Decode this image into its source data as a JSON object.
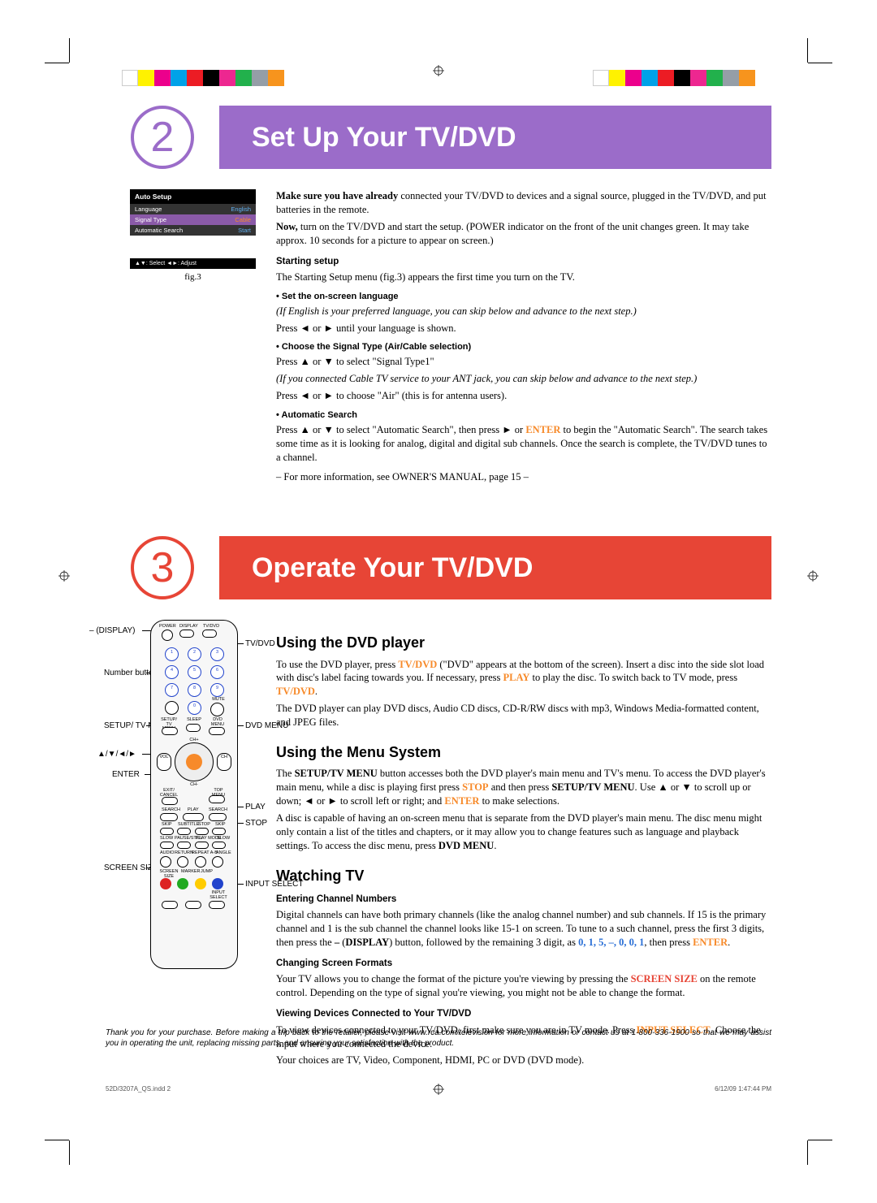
{
  "colorbar": [
    "#ffffff",
    "#fff200",
    "#ec008c",
    "#00a2e8",
    "#ec1c24",
    "#000000",
    "#ed2790",
    "#22b14c",
    "#959ea7",
    "#f7941d"
  ],
  "section2": {
    "number": "2",
    "title": "Set Up Your TV/DVD",
    "auto_setup": {
      "title": "Auto Setup",
      "rows": [
        {
          "label": "Language",
          "value": "English",
          "class": "en",
          "hl": false
        },
        {
          "label": "Signal Type",
          "value": "Cable",
          "class": "cable",
          "hl": true
        },
        {
          "label": "Automatic Search",
          "value": "Start",
          "class": "start",
          "hl": false
        }
      ],
      "footer": "▲▼: Select    ◄►: Adjust",
      "caption": "fig.3"
    },
    "intro1_bold": "Make sure you have already",
    "intro1_rest": " connected your TV/DVD to devices and a signal source, plugged in the TV/DVD, and put batteries in the remote.",
    "intro2_bold": "Now,",
    "intro2_rest": " turn on the TV/DVD and start the setup. (POWER indicator on the front of the unit changes green. It may take approx. 10 seconds for a picture to appear on screen.)",
    "starting_setup": "Starting setup",
    "starting_text": "The Starting Setup menu (fig.3) appears the first time you turn on the TV.",
    "onscreen_head": "• Set the on-screen language",
    "onscreen_italic": "(If English is your preferred language, you can skip below and advance to the next step.)",
    "onscreen_text": "Press ◄ or ► until your language is shown.",
    "signal_head": "• Choose the Signal Type (Air/Cable selection)",
    "signal_text1": "Press ▲ or ▼ to select \"Signal Type1\"",
    "signal_italic": "(If you connected Cable TV service to your ANT jack, you can skip below and advance to the next step.)",
    "signal_text2": "Press ◄ or ► to choose \"Air\" (this is for antenna users).",
    "auto_head": "• Automatic Search",
    "auto_text1_a": "Press ▲ or ▼ to select \"Automatic Search\", then press ► or ",
    "auto_text1_enter": "ENTER",
    "auto_text1_b": " to begin the \"Automatic Search\". The search takes some time as it is looking for analog, digital and digital sub channels. Once the search is complete, the TV/DVD tunes to a channel.",
    "more_info": "– For more information, see OWNER'S MANUAL, page 15 –"
  },
  "section3": {
    "number": "3",
    "title": "Operate Your TV/DVD",
    "dvd_head": "Using the DVD player",
    "dvd_p1_a": "To use the DVD player, press ",
    "dvd_p1_tvdvd": "TV/DVD",
    "dvd_p1_b": " (\"DVD\" appears at the bottom of the screen). Insert a disc into the side slot load with disc's label facing towards you. If necessary, press ",
    "dvd_p1_play": "PLAY",
    "dvd_p1_c": " to play the disc. To switch back to TV mode, press ",
    "dvd_p1_tvdvd2": "TV/DVD",
    "dvd_p1_d": ".",
    "dvd_p2": "The DVD player can play DVD discs, Audio CD discs, CD-R/RW discs with mp3, Windows Media-formatted content, and JPEG files.",
    "menu_head": "Using the Menu System",
    "menu_p1_a": "The ",
    "menu_p1_setup": "SETUP/TV MENU",
    "menu_p1_b": " button accesses both the DVD player's main menu and TV's menu. To access the DVD player's main menu, while a disc is playing first press ",
    "menu_p1_stop": "STOP",
    "menu_p1_c": " and then press ",
    "menu_p1_setup2": "SETUP/TV MENU",
    "menu_p1_d": ". Use ▲ or ▼ to scroll up or down; ◄ or ► to scroll left or right; and ",
    "menu_p1_enter": "ENTER",
    "menu_p1_e": " to make selections.",
    "menu_p2_a": "A disc is capable of having an on-screen menu that is separate from the DVD player's main menu. The disc menu might only contain a list of the titles and chapters, or it may allow you to change features such as language and playback settings. To access the disc menu, press ",
    "menu_p2_dvdmenu": "DVD MENU",
    "menu_p2_b": ".",
    "watch_head": "Watching TV",
    "entering_head": "Entering Channel Numbers",
    "entering_a": "Digital channels can have both primary channels (like the analog channel number) and sub channels. If 15 is the primary channel and 1 is the sub channel the channel looks like 15-1 on screen. To tune to a such channel, press the first 3 digits, then press the ",
    "entering_dash": "–",
    "entering_b": " (",
    "entering_display": "DISPLAY",
    "entering_c": ") button, followed by the remaining 3 digit, as ",
    "entering_digits": "0, 1, 5, –, 0, 0, 1",
    "entering_d": ", then press ",
    "entering_enter": "ENTER",
    "entering_e": ".",
    "format_head": "Changing Screen Formats",
    "format_a": "Your TV allows you to change the format of the picture you're viewing by pressing the ",
    "format_size": "SCREEN SIZE",
    "format_b": " on the remote control. Depending on the type of signal you're viewing, you might not be able to change the format.",
    "devices_head": "Viewing Devices Connected to Your TV/DVD",
    "devices_a": "To view devices connected to your TV/DVD, first make sure you are in TV mode. Press ",
    "devices_input": "INPUT SELECT",
    "devices_b": ". Choose the input where you connected the device.",
    "devices_c": "Your choices are TV, Video, Component, HDMI, PC or DVD (DVD mode).",
    "callouts": {
      "display": "– (DISPLAY)",
      "tvdvd": "TV/DVD",
      "number": "Number buttons",
      "setup": "SETUP/ TV MENU",
      "dvdmenu": "DVD MENU",
      "arrows": "▲/▼/◄/►",
      "enter": "ENTER",
      "play": "PLAY",
      "stop": "STOP",
      "screen": "SCREEN SIZE",
      "input": "INPUT SELECT"
    }
  },
  "footnote": "Thank you for your purchase. Before making a trip back to the retailer, please visit www.rca.com/television for more information or contact us at 1-800-336-1900 so that we may assist you in operating the unit, replacing missing parts, and ensuring your satisfaction with the product.",
  "footer_left": "52D/3207A_QS.indd   2",
  "footer_right": "6/12/09   1:47:44 PM"
}
